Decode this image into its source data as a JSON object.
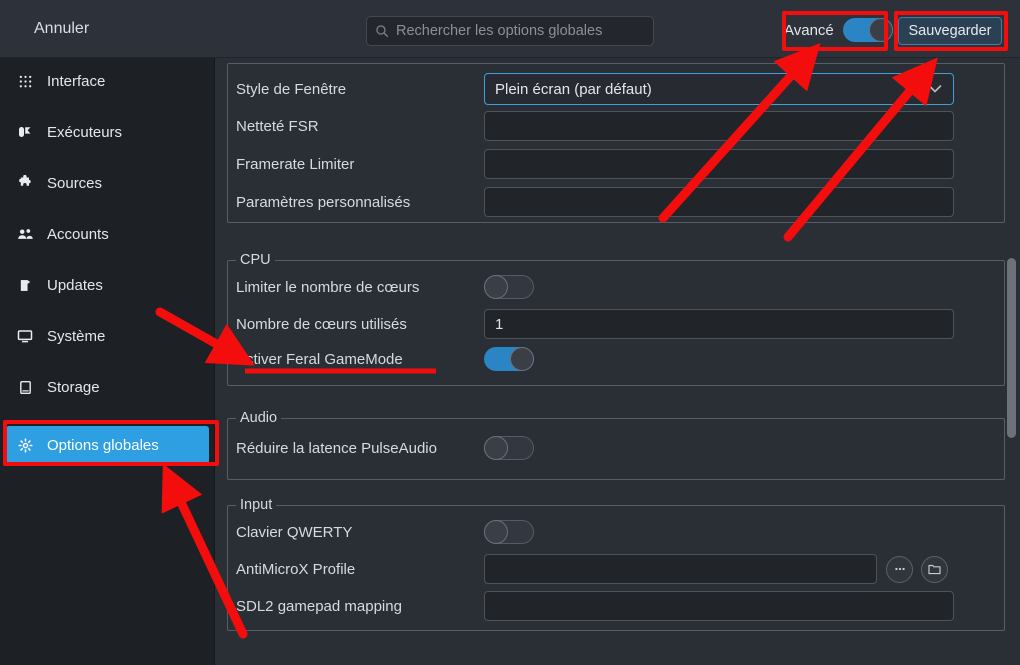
{
  "header": {
    "cancel_label": "Annuler",
    "search_placeholder": "Rechercher les options globales",
    "search_value": "",
    "search_icon": "search-icon",
    "advanced_label": "Avancé",
    "advanced_on": true,
    "save_label": "Sauvegarder"
  },
  "sidebar": {
    "items": [
      {
        "label": "Interface",
        "icon": "grid-dots-icon",
        "active": false
      },
      {
        "label": "Exécuteurs",
        "icon": "rocket-icon",
        "active": false
      },
      {
        "label": "Sources",
        "icon": "puzzle-icon",
        "active": false
      },
      {
        "label": "Accounts",
        "icon": "people-icon",
        "active": false
      },
      {
        "label": "Updates",
        "icon": "package-icon",
        "active": false
      },
      {
        "label": "Système",
        "icon": "monitor-icon",
        "active": false
      },
      {
        "label": "Storage",
        "icon": "drive-icon",
        "active": false
      },
      {
        "label": "Options globales",
        "icon": "gear-icon",
        "active": true
      }
    ]
  },
  "main": {
    "display_group": {
      "rows": [
        {
          "label": "Style de Fenêtre",
          "type": "combo",
          "value": "Plein écran (par défaut)",
          "focused": true
        },
        {
          "label": "Netteté FSR",
          "type": "text",
          "value": ""
        },
        {
          "label": "Framerate Limiter",
          "type": "text",
          "value": ""
        },
        {
          "label": "Paramètres personnalisés",
          "type": "text",
          "value": ""
        }
      ]
    },
    "cpu_group": {
      "title": "CPU",
      "rows": [
        {
          "label": "Limiter le nombre de cœurs",
          "type": "toggle",
          "on": false
        },
        {
          "label": "Nombre de cœurs utilisés",
          "type": "text",
          "value": "1"
        },
        {
          "label": "Activer Feral GameMode",
          "type": "toggle",
          "on": true
        }
      ]
    },
    "audio_group": {
      "title": "Audio",
      "rows": [
        {
          "label": "Réduire la latence PulseAudio",
          "type": "toggle",
          "on": false
        }
      ]
    },
    "input_group": {
      "title": "Input",
      "rows": [
        {
          "label": "Clavier QWERTY",
          "type": "toggle",
          "on": false
        },
        {
          "label": "AntiMicroX Profile",
          "type": "text-with-buttons",
          "value": "",
          "buttons": [
            {
              "icon": "ellipsis-icon",
              "label": "…"
            },
            {
              "icon": "folder-icon",
              "label": ""
            }
          ]
        },
        {
          "label": "SDL2 gamepad mapping",
          "type": "text",
          "value": ""
        }
      ]
    }
  },
  "annotations": {
    "color": "#f40d0d",
    "boxes": [
      {
        "name": "advanced-toggle-highlight"
      },
      {
        "name": "save-button-highlight"
      },
      {
        "name": "options-globales-highlight"
      }
    ],
    "underlines": [
      {
        "name": "feral-gamemode-underline"
      }
    ],
    "arrows": [
      {
        "name": "arrow-to-advanced-toggle"
      },
      {
        "name": "arrow-to-window-style-dropdown"
      },
      {
        "name": "arrow-to-feral-gamemode"
      },
      {
        "name": "arrow-to-options-globales"
      }
    ]
  }
}
